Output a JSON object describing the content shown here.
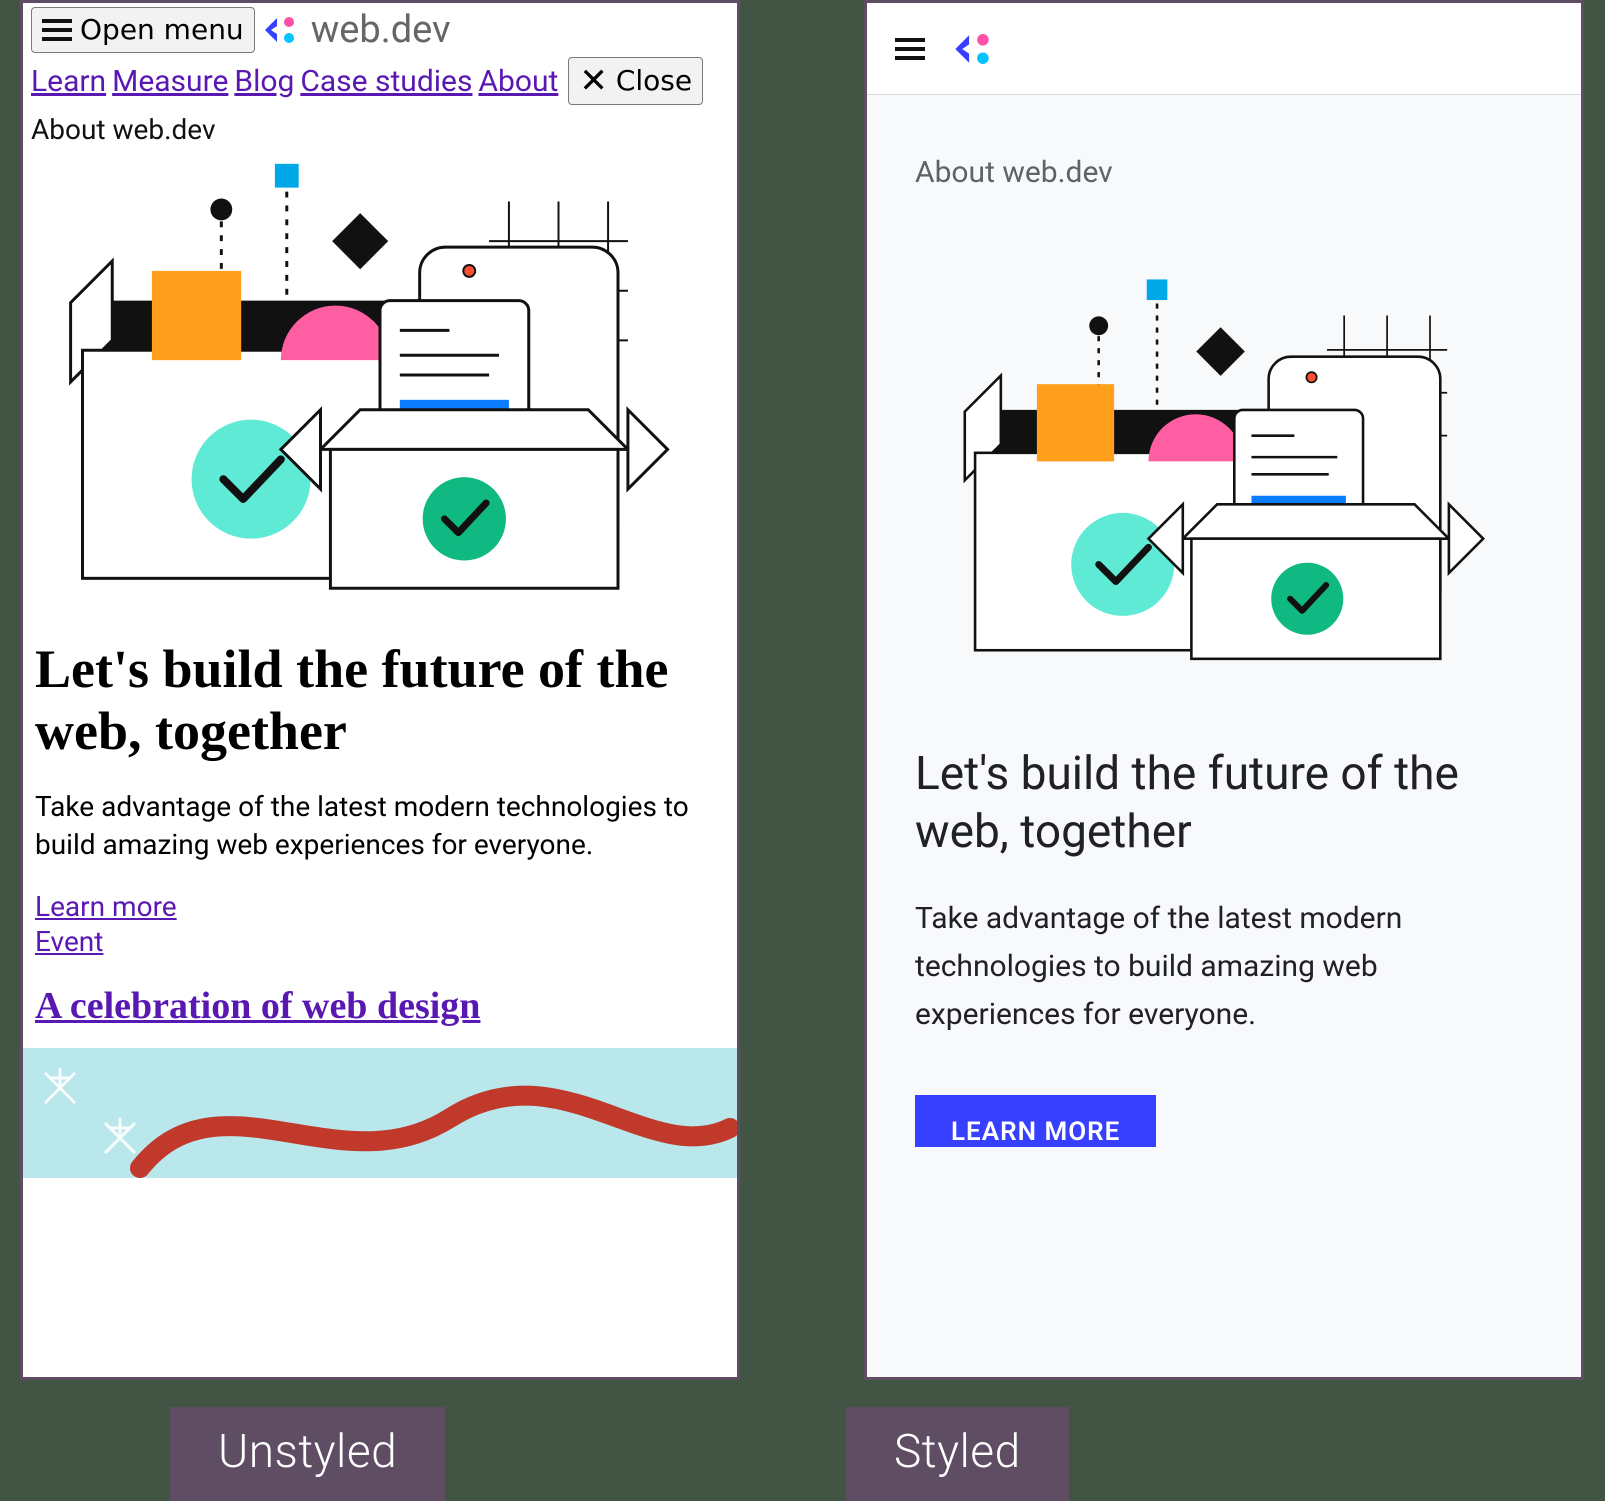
{
  "labels": {
    "left": "Unstyled",
    "right": "Styled"
  },
  "brand": {
    "name": "web.dev"
  },
  "unstyled": {
    "open_menu": "Open menu",
    "close": "Close",
    "nav": {
      "learn": "Learn",
      "measure": "Measure",
      "blog": "Blog",
      "case_studies": "Case studies",
      "about": "About"
    },
    "eyebrow": "About web.dev",
    "h1": "Let's build the future of the web, together",
    "p": "Take advantage of the latest modern technologies to build amazing web experiences for everyone.",
    "learn_more": "Learn more",
    "event": "Event",
    "h2": "A celebration of web design"
  },
  "styled": {
    "eyebrow": "About web.dev",
    "h1": "Let's build the future of the web, together",
    "p": "Take advantage of the latest modern technologies to build amazing web experiences for everyone.",
    "cta": "LEARN MORE"
  }
}
